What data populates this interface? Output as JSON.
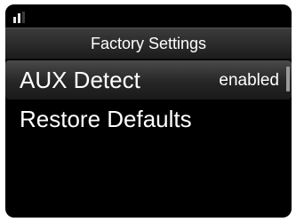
{
  "status_bar": {
    "signal_icon": "signal-strength-icon",
    "signal_bars_filled": 2,
    "signal_bars_total": 3
  },
  "header": {
    "title": "Factory Settings"
  },
  "menu": {
    "items": [
      {
        "label": "AUX Detect",
        "value": "enabled",
        "selected": true
      },
      {
        "label": "Restore Defaults",
        "value": "",
        "selected": false
      }
    ]
  },
  "colors": {
    "background": "#000000",
    "text": "#ffffff",
    "highlight": "#3a3a3a"
  }
}
